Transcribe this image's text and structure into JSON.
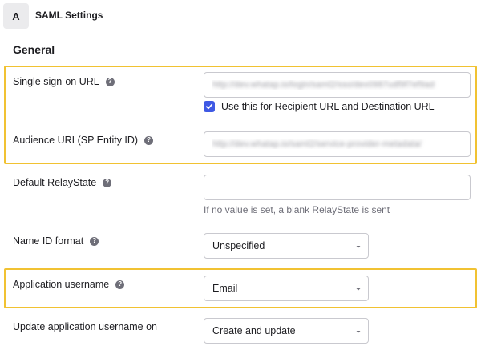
{
  "step": {
    "badge": "A",
    "title": "SAML Settings"
  },
  "section": {
    "title": "General"
  },
  "fields": {
    "sso_url": {
      "label": "Single sign-on URL",
      "value": "http://dev.whatap.io/login/saml2/sso/dev0987udf9f7ef9ad"
    },
    "recipient_checkbox": {
      "label": "Use this for Recipient URL and Destination URL",
      "checked": true
    },
    "audience_uri": {
      "label": "Audience URI (SP Entity ID)",
      "value": "http://dev.whatap.io/saml2/service-provider-metadata/"
    },
    "relay_state": {
      "label": "Default RelayState",
      "value": "",
      "hint": "If no value is set, a blank RelayState is sent"
    },
    "name_id_format": {
      "label": "Name ID format",
      "selected": "Unspecified"
    },
    "app_username": {
      "label": "Application username",
      "selected": "Email"
    },
    "update_username": {
      "label": "Update application username on",
      "selected": "Create and update"
    }
  },
  "colors": {
    "highlight": "#f1c232",
    "checkbox": "#3f59e4",
    "help_icon": "#6e6e78"
  },
  "icons": {
    "help": "help-icon",
    "check": "check-icon",
    "dropdown": "chevron-down-icon"
  }
}
